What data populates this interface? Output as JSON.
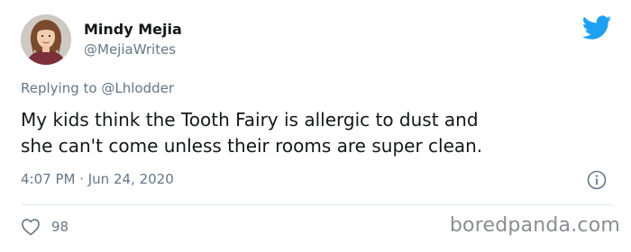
{
  "author": {
    "name": "Mindy Mejia",
    "handle": "@MejiaWrites"
  },
  "reply": {
    "prefix": "Replying to",
    "mention": "@Lhlodder"
  },
  "tweet": {
    "text_line1": "My kids think the Tooth Fairy is allergic to dust and",
    "text_line2": "she can't come unless their rooms are super clean.",
    "timestamp": "4:07 PM · Jun 24, 2020"
  },
  "actions": {
    "likes": "98"
  },
  "watermark": "boredpanda.com",
  "colors": {
    "twitter_blue": "#1da1f2",
    "text_primary": "#14171a",
    "text_secondary": "#657786",
    "divider": "#e1e8ed"
  },
  "icons": {
    "brand": "twitter-bird-icon",
    "info": "info-icon",
    "like": "heart-icon"
  }
}
